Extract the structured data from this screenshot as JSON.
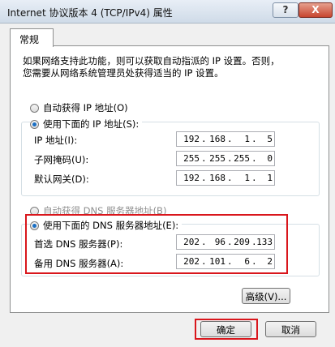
{
  "window": {
    "title": "Internet 协议版本 4 (TCP/IPv4) 属性",
    "help_label": "?",
    "close_label": "X"
  },
  "tab": {
    "label": "常规"
  },
  "description": {
    "line1": "如果网络支持此功能，则可以获取自动指派的 IP 设置。否则，",
    "line2": "您需要从网络系统管理员处获得适当的 IP 设置。"
  },
  "ip_section": {
    "auto_label": "自动获得 IP 地址(O)",
    "manual_label": "使用下面的 IP 地址(S):",
    "selected": "manual",
    "fields": [
      {
        "label": "IP 地址(I):",
        "octets": [
          "192",
          "168",
          "1",
          "5"
        ]
      },
      {
        "label": "子网掩码(U):",
        "octets": [
          "255",
          "255",
          "255",
          "0"
        ]
      },
      {
        "label": "默认网关(D):",
        "octets": [
          "192",
          "168",
          "1",
          "1"
        ]
      }
    ]
  },
  "dns_section": {
    "auto_label": "自动获得 DNS 服务器地址(B)",
    "manual_label": "使用下面的 DNS 服务器地址(E):",
    "selected": "manual",
    "fields": [
      {
        "label": "首选 DNS 服务器(P):",
        "octets": [
          "202",
          "96",
          "209",
          "133"
        ]
      },
      {
        "label": "备用 DNS 服务器(A):",
        "octets": [
          "202",
          "101",
          "6",
          "2"
        ]
      }
    ]
  },
  "buttons": {
    "advanced": "高级(V)...",
    "ok": "确定",
    "cancel": "取消"
  },
  "colors": {
    "highlight": "#d9161c",
    "selection": "#1a6fc4"
  }
}
